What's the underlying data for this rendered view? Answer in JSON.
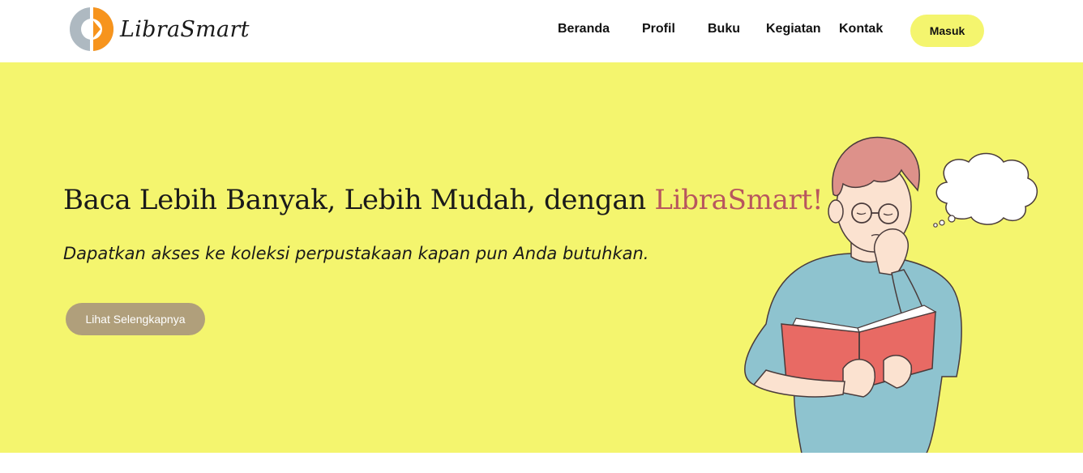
{
  "header": {
    "brand": "LibraSmart",
    "nav": [
      {
        "label": "Beranda"
      },
      {
        "label": "Profil"
      },
      {
        "label": "Buku"
      },
      {
        "label": "Kegiatan"
      },
      {
        "label": "Kontak"
      }
    ],
    "login_label": "Masuk"
  },
  "hero": {
    "title_prefix": "Baca Lebih Banyak, Lebih Mudah, dengan ",
    "title_brand": "LibraSmart!",
    "subtitle": "Dapatkan akses ke koleksi perpustakaan kapan pun Anda butuhkan.",
    "cta_label": "Lihat Selengkapnya"
  },
  "colors": {
    "accent_yellow": "#f4f56e",
    "brand_text": "#b8565e",
    "cta_button": "#b09f7b",
    "logo_orange": "#f7941d",
    "logo_gray": "#aeb9c1"
  },
  "icons": {
    "logo": "librasmart-logo-icon",
    "illustration": "reading-person-illustration"
  }
}
